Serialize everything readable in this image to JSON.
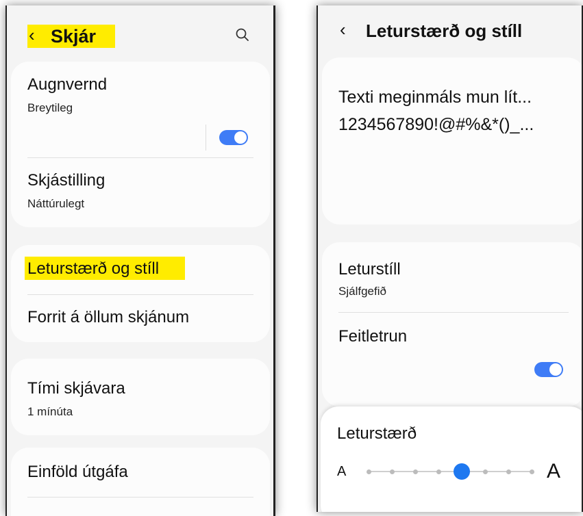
{
  "left": {
    "header": {
      "back_icon": "chevron-left-icon",
      "title": "Skjár",
      "search_icon": "search-icon"
    },
    "eye_comfort": {
      "title": "Augnvernd",
      "subtitle": "Breytileg",
      "toggle_on": true
    },
    "screen_mode": {
      "title": "Skjástilling",
      "subtitle": "Náttúrulegt"
    },
    "font_size_style": {
      "title": "Leturstærð og stíll"
    },
    "full_screen_apps": {
      "title": "Forrit á öllum skjánum"
    },
    "screen_timeout": {
      "title": "Tími skjávara",
      "subtitle": "1 mínúta"
    },
    "easy_mode": {
      "title": "Einföld útgáfa"
    }
  },
  "right": {
    "header": {
      "back_icon": "chevron-left-icon",
      "title": "Leturstærð og stíll"
    },
    "preview": {
      "line1": "Texti meginmáls mun lít...",
      "line2": "1234567890!@#%&*()_..."
    },
    "font_style": {
      "title": "Leturstíll",
      "subtitle": "Sjálfgefið"
    },
    "bold_font": {
      "title": "Feitletrun",
      "toggle_on": true
    },
    "font_size": {
      "title": "Leturstærð",
      "small_label": "A",
      "large_label": "A",
      "steps": 8,
      "selected_step": 4
    }
  },
  "colors": {
    "highlight": "#ffec00",
    "accent": "#3f7cf6",
    "slider": "#1e78f0"
  }
}
